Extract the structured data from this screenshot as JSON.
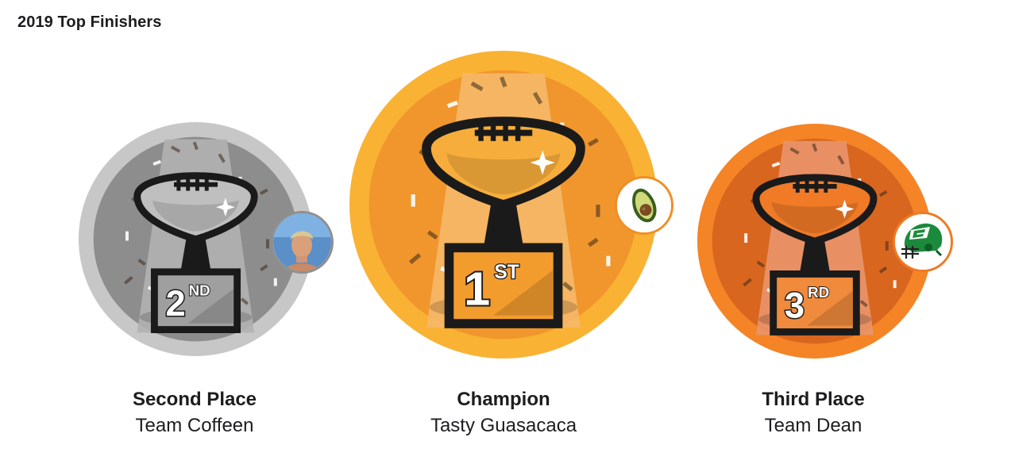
{
  "section": {
    "title": "2019 Top Finishers"
  },
  "finishers": [
    {
      "id": "second",
      "place_label": "Second Place",
      "team_name": "Team Coffeen",
      "rank_number": "2",
      "rank_suffix": "ND",
      "avatar_icon": "person-photo-icon",
      "colors": {
        "ring": "#c7c7c7",
        "base": "#8d8d8d",
        "beam": "#b1b1b1",
        "plate": "#9f9f9f",
        "ball": "#bfbfbf",
        "avatar_border": "#8f8f8f"
      }
    },
    {
      "id": "first",
      "place_label": "Champion",
      "team_name": "Tasty Guasacaca",
      "rank_number": "1",
      "rank_suffix": "ST",
      "avatar_icon": "avocado-icon",
      "colors": {
        "ring": "#f9b233",
        "base": "#f0962c",
        "beam": "#f6b868",
        "plate": "#f39c2e",
        "ball": "#f7ad3b",
        "avatar_border": "#ef8f26"
      }
    },
    {
      "id": "third",
      "place_label": "Third Place",
      "team_name": "Team Dean",
      "rank_number": "3",
      "rank_suffix": "RD",
      "avatar_icon": "football-helmet-icon",
      "colors": {
        "ring": "#f48426",
        "base": "#d9661f",
        "beam": "#e9956b",
        "plate": "#f08a3c",
        "ball": "#f07a26",
        "avatar_border": "#ef7a23"
      }
    }
  ]
}
